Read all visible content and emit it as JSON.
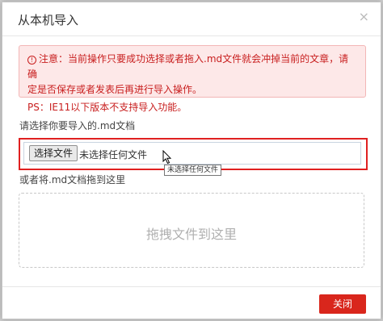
{
  "dialog": {
    "title": "从本机导入",
    "close_icon": "×"
  },
  "alert": {
    "icon": "!",
    "line1": "注意：当前操作只要成功选择或者拖入.md文件就会冲掉当前的文章，请确",
    "line2": "定是否保存或者发表后再进行导入操作。",
    "line3": "PS：IE11以下版本不支持导入功能。",
    "color": "#c81e1e"
  },
  "file_select": {
    "label": "请选择你要导入的.md文档",
    "button_label": "选择文件",
    "status_text": "未选择任何文件",
    "tooltip": "未选择任何文件"
  },
  "drag": {
    "label": "或者将.md文档拖到这里",
    "dropzone_text": "拖拽文件到这里"
  },
  "footer": {
    "close_label": "关闭",
    "accent": "#d9261c"
  }
}
